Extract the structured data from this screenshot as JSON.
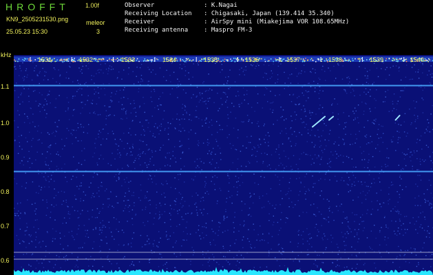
{
  "header": {
    "app_title": "HROFFT",
    "version": "1.00f",
    "file_name": "KN9_2505231530.png",
    "timestamp": "25.05.23 15:30",
    "count_label": "meleor",
    "count_value": "3",
    "info": [
      {
        "label": "Observer",
        "value": ": K.Nagai"
      },
      {
        "label": "Receiving Location",
        "value": ": Chigasaki, Japan (139.414 35.340)"
      },
      {
        "label": "Receiver",
        "value": ": AirSpy mini (Miakejima VOR 108.65MHz)"
      },
      {
        "label": "Receiving antenna",
        "value": ": Maspro FM-3"
      }
    ]
  },
  "colors": {
    "background": "#0a1076",
    "title_green": "#6fdc3a",
    "label_yellow": "#f2f25c",
    "trace_cyan": "#29e7ff"
  },
  "chart_data": {
    "type": "heatmap",
    "ylabel": "kHz",
    "y_ticks": [
      "1.1",
      "1.0",
      "0.9",
      "0.8",
      "0.7",
      "0.6"
    ],
    "x_ticks": [
      "1531",
      "1532",
      "1533",
      "1534",
      "1535",
      "1536",
      "1537",
      "1538",
      "1539",
      "1540"
    ],
    "ylim": [
      0.58,
      1.14
    ],
    "carrier_lines_khz": [
      1.105,
      0.855
    ],
    "meteor_echoes": [
      {
        "x": [
          1537.5,
          1537.8
        ],
        "y": [
          0.985,
          1.015
        ]
      },
      {
        "x": [
          1537.9,
          1538.0
        ],
        "y": [
          1.005,
          1.015
        ]
      },
      {
        "x": [
          1539.5,
          1539.6
        ],
        "y": [
          1.005,
          1.018
        ]
      }
    ]
  }
}
